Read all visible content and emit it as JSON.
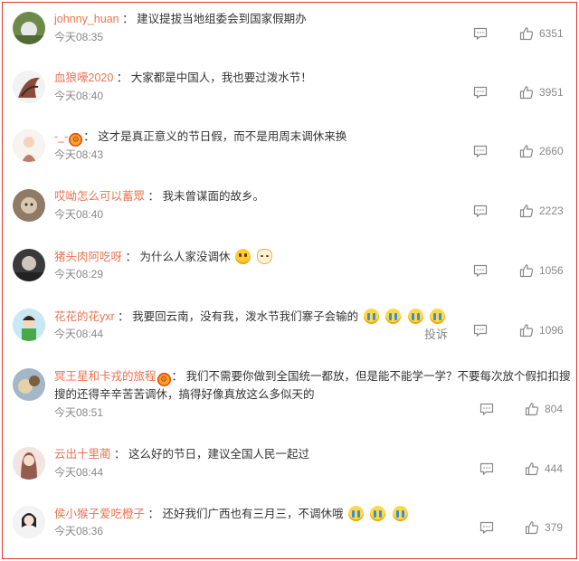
{
  "accent": "#e0322b",
  "username_color": "#eb7350",
  "comments": [
    {
      "user": "johnny_huan",
      "text": "建议提拔当地组委会到国家假期办",
      "time": "今天08:35",
      "likes": "6351"
    },
    {
      "user": "血狼嚎2020",
      "text": "大家都是中国人，我也要过泼水节！",
      "time": "今天08:40",
      "likes": "3951"
    },
    {
      "user": "-_-",
      "text": "这才是真正意义的节日假，而不是用周末调休来换",
      "time": "今天08:43",
      "likes": "2660"
    },
    {
      "user": "哎呦怎么可以蓄眾",
      "text": "我未曾谋面的故乡。",
      "time": "今天08:40",
      "likes": "2223"
    },
    {
      "user": "猪头肉阿吃呀",
      "text": "为什么人家没调休",
      "time": "今天08:29",
      "likes": "1056"
    },
    {
      "user": "花花的花yxr",
      "text": "我要回云南，没有我，泼水节我们寨子会输的",
      "time": "今天08:44",
      "likes": "1096",
      "report": "投诉"
    },
    {
      "user": "冥王星和卡戎的旅程",
      "text": "我们不需要你做到全国统一都放，但是能不能学一学？不要每次放个假扣扣搜搜的还得辛辛苦苦调休，搞得好像真放这么多似天的",
      "time": "今天08:51",
      "likes": "804"
    },
    {
      "user": "云出十里蔺",
      "text": "这么好的节日，建议全国人民一起过",
      "time": "今天08:44",
      "likes": "444"
    },
    {
      "user": "侯小猴子爱吃橙子",
      "text": "还好我们广西也有三月三，不调休哦",
      "time": "今天08:36",
      "likes": "379"
    }
  ],
  "icons": {
    "comment": "comment-icon",
    "like": "thumbs-up-icon",
    "badge": "vip-badge-icon"
  }
}
